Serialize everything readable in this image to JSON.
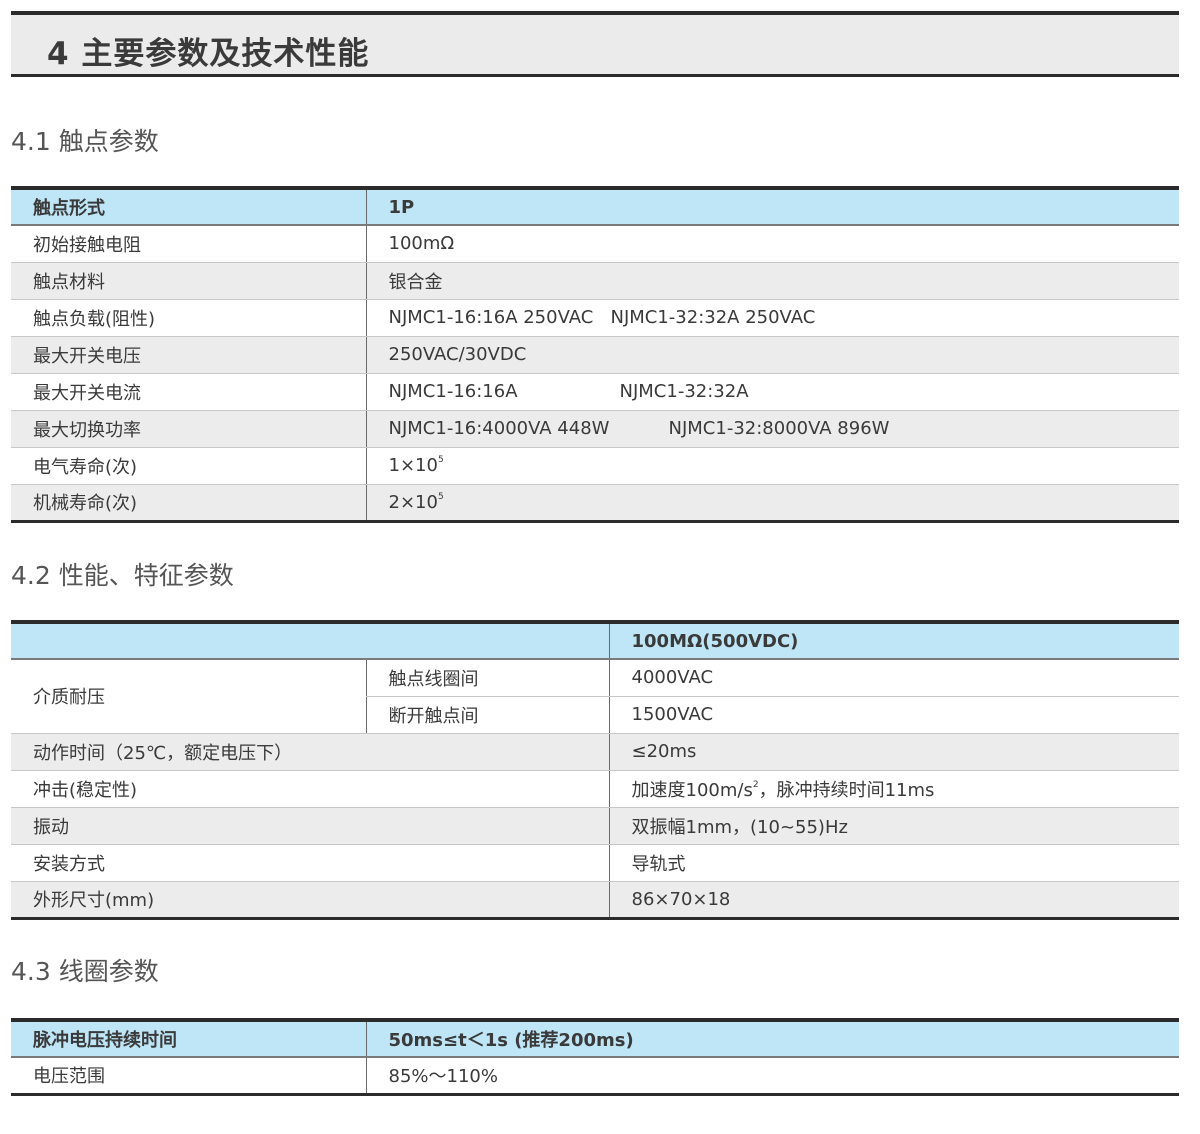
{
  "banner": {
    "title": "4 主要参数及技术性能"
  },
  "sections": {
    "s1": {
      "title": "4.1 触点参数",
      "header": [
        "触点形式",
        "1P"
      ],
      "rows": [
        {
          "label": "初始接触电阻",
          "value": "100mΩ"
        },
        {
          "label": "触点材料",
          "value": "银合金"
        },
        {
          "label": "触点负载(阻性)",
          "value": "NJMC1-16:16A 250VAC   NJMC1-32:32A 250VAC"
        },
        {
          "label": "最大开关电压",
          "value": "250VAC/30VDC"
        },
        {
          "label": "最大开关电流",
          "value_a": "NJMC1-16:16A",
          "value_b": "NJMC1-32:32A"
        },
        {
          "label": "最大切换功率",
          "value_a": "NJMC1-16:4000VA  448W",
          "value_b": "NJMC1-32:8000VA  896W"
        },
        {
          "label": "电气寿命(次)",
          "base": "1×10",
          "exp": "5"
        },
        {
          "label": "机械寿命(次)",
          "base": "2×10",
          "exp": "5"
        }
      ]
    },
    "s2": {
      "title": "4.2 性能、特征参数",
      "header": [
        "",
        "100MΩ(500VDC)"
      ],
      "dielectric": {
        "label": "介质耐压",
        "sub": [
          {
            "label": "触点线圈间",
            "value": "4000VAC"
          },
          {
            "label": "断开触点间",
            "value": "1500VAC"
          }
        ]
      },
      "rows": [
        {
          "label": "动作时间（25℃，额定电压下）",
          "value": "≤20ms"
        },
        {
          "label": "冲击(稳定性)",
          "value_pre": "加速度100m/s",
          "exp": "2",
          "value_post": "，脉冲持续时间11ms"
        },
        {
          "label": "振动",
          "value": "双振幅1mm，(10~55)Hz"
        },
        {
          "label": "安装方式",
          "value": "导轨式"
        },
        {
          "label": "外形尺寸(mm)",
          "value": "86×70×18"
        }
      ]
    },
    "s3": {
      "title": "4.3 线圈参数",
      "header": [
        "脉冲电压持续时间",
        "50ms≤t＜1s (推荐200ms)"
      ],
      "rows": [
        {
          "label": "电压范围",
          "value": "85%～110%"
        }
      ]
    }
  }
}
